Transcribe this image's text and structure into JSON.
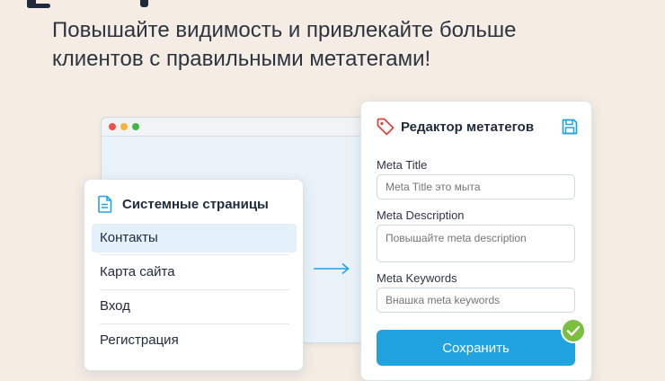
{
  "headline": {
    "line1": "Повышайте видимость и привлекайте больше",
    "line2": "клиентов с правильными метатегами!"
  },
  "browser": {
    "dots": [
      "red",
      "yellow",
      "green"
    ],
    "dot_colors": [
      "#e9524a",
      "#f1b53a",
      "#42b649"
    ]
  },
  "pages_panel": {
    "title": "Системные страницы",
    "icon": "document-icon",
    "items": [
      {
        "label": "Контакты",
        "active": true
      },
      {
        "label": "Карта сайта",
        "active": false
      },
      {
        "label": "Вход",
        "active": false
      },
      {
        "label": "Регистрация",
        "active": false
      }
    ]
  },
  "editor": {
    "title": "Редактор метатегов",
    "tag_icon": "tag-icon",
    "save_icon": "save-icon",
    "fields": {
      "title": {
        "label": "Meta Title",
        "placeholder": "Meta Title это мыта"
      },
      "description": {
        "label": "Meta Description",
        "placeholder": "Повышайте meta description"
      },
      "keywords": {
        "label": "Meta Keywords",
        "placeholder": "Внашка meta keywords"
      }
    },
    "save_label": "Сохранить",
    "success_icon": "check-circle-icon"
  },
  "colors": {
    "background": "#f5ede3",
    "accent": "#20a3df",
    "tag_red": "#e0453c",
    "success": "#7cbf3f",
    "active_row": "#e4f0fa"
  }
}
